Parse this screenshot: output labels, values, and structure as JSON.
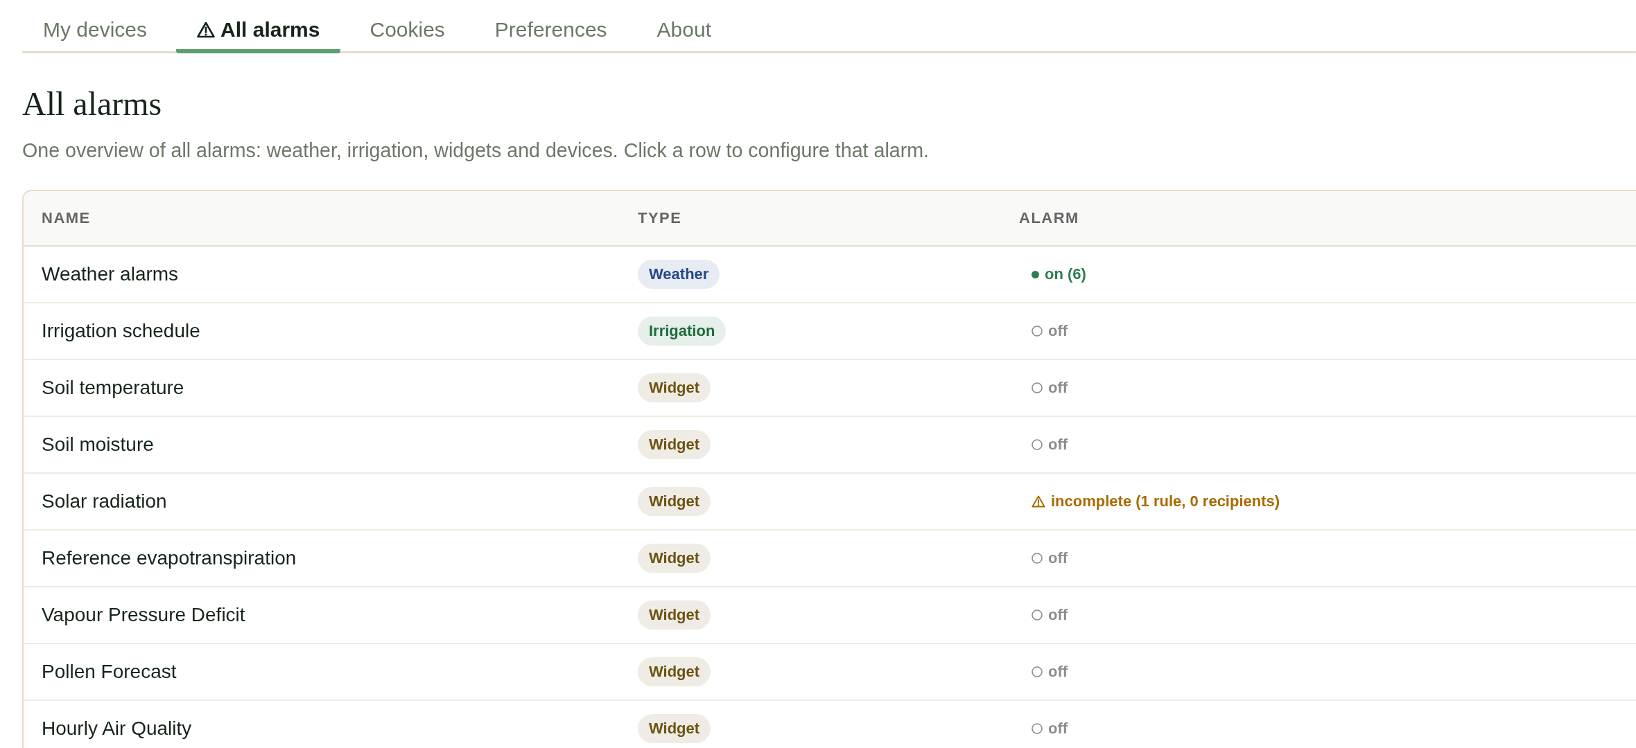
{
  "tabs": [
    {
      "label": "My devices",
      "selected": false,
      "alert": false
    },
    {
      "label": "All alarms",
      "selected": true,
      "alert": true
    },
    {
      "label": "Cookies",
      "selected": false,
      "alert": false
    },
    {
      "label": "Preferences",
      "selected": false,
      "alert": false
    },
    {
      "label": "About",
      "selected": false,
      "alert": false
    }
  ],
  "page": {
    "title": "All alarms",
    "description": "One overview of all alarms: weather, irrigation, widgets and devices. Click a row to configure that alarm."
  },
  "table": {
    "columns": [
      "NAME",
      "TYPE",
      "ALARM"
    ],
    "rows": [
      {
        "name": "Weather alarms",
        "type": {
          "label": "Weather",
          "color": "#27488a"
        },
        "alarm": {
          "kind": "on",
          "label": "on (6)"
        }
      },
      {
        "name": "Irrigation schedule",
        "type": {
          "label": "Irrigation",
          "color": "#1d6a3b"
        },
        "alarm": {
          "kind": "off",
          "label": "off"
        }
      },
      {
        "name": "Soil temperature",
        "type": {
          "label": "Widget",
          "color": "#6d5312"
        },
        "alarm": {
          "kind": "off",
          "label": "off"
        }
      },
      {
        "name": "Soil moisture",
        "type": {
          "label": "Widget",
          "color": "#6d5312"
        },
        "alarm": {
          "kind": "off",
          "label": "off"
        }
      },
      {
        "name": "Solar radiation",
        "type": {
          "label": "Widget",
          "color": "#6d5312"
        },
        "alarm": {
          "kind": "incomplete",
          "label": "incomplete (1 rule, 0 recipients)"
        }
      },
      {
        "name": "Reference evapotranspiration",
        "type": {
          "label": "Widget",
          "color": "#6d5312"
        },
        "alarm": {
          "kind": "off",
          "label": "off"
        }
      },
      {
        "name": "Vapour Pressure Deficit",
        "type": {
          "label": "Widget",
          "color": "#6d5312"
        },
        "alarm": {
          "kind": "off",
          "label": "off"
        }
      },
      {
        "name": "Pollen Forecast",
        "type": {
          "label": "Widget",
          "color": "#6d5312"
        },
        "alarm": {
          "kind": "off",
          "label": "off"
        }
      },
      {
        "name": "Hourly Air Quality",
        "type": {
          "label": "Widget",
          "color": "#6d5312"
        },
        "alarm": {
          "kind": "off",
          "label": "off"
        }
      }
    ]
  }
}
